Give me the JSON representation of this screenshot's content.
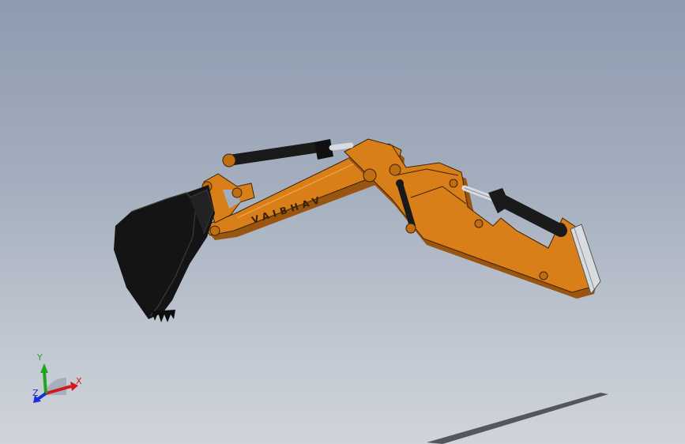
{
  "model": {
    "arm_engraving": "VAIBHAV",
    "colors": {
      "background_top": "#8e9cb0",
      "background_bottom": "#d0d4da",
      "arm_orange": "#d97f1a",
      "arm_shadow": "#9a5610",
      "bucket_black": "#141414",
      "cylinder_black": "#1a1a1a",
      "rod_silver": "#d8dbe0"
    }
  },
  "triad": {
    "x_label": "X",
    "y_label": "Y",
    "z_label": "Z",
    "colors": {
      "x": "#d11a1a",
      "y": "#1fa51f",
      "z": "#1a2fd1"
    }
  }
}
